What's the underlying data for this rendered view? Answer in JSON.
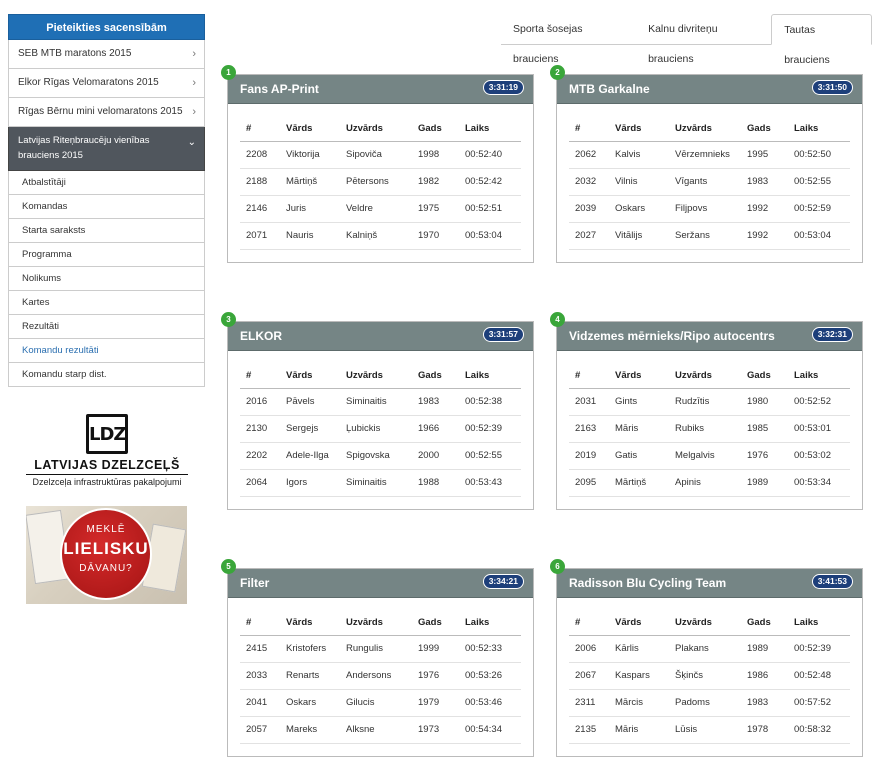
{
  "sidebar": {
    "header": "Pieteikties sacensībām",
    "items": [
      {
        "label": "SEB MTB maratons 2015"
      },
      {
        "label": "Elkor Rīgas Velomaratons 2015"
      },
      {
        "label": "Rīgas Bērnu mini velomaratons 2015"
      }
    ],
    "active": {
      "label": "Latvijas Riteņbraucēju vienības brauciens 2015"
    },
    "sub_items": [
      {
        "label": "Atbalstītāji"
      },
      {
        "label": "Komandas"
      },
      {
        "label": "Starta saraksts"
      },
      {
        "label": "Programma"
      },
      {
        "label": "Nolikums"
      },
      {
        "label": "Kartes"
      },
      {
        "label": "Rezultāti"
      },
      {
        "label": "Komandu rezultāti"
      },
      {
        "label": "Komandu starp dist."
      }
    ]
  },
  "ads": {
    "ldz": {
      "name": "LATVIJAS DZELZCEĻŠ",
      "tagline": "Dzelzceļa infrastruktūras pakalpojumi",
      "logo_text": "LDZ"
    },
    "promo": {
      "line1": "MEKLĒ",
      "line2": "LIELISKU",
      "line3": "DĀVANU?"
    }
  },
  "tabs": [
    {
      "label": "Sporta šosejas brauciens",
      "active": false
    },
    {
      "label": "Kalnu divriteņu brauciens",
      "active": false
    },
    {
      "label": "Tautas brauciens",
      "active": true
    }
  ],
  "columns": [
    "#",
    "Vārds",
    "Uzvārds",
    "Gads",
    "Laiks"
  ],
  "teams": [
    {
      "rank": "1",
      "name": "Fans AP-Print",
      "time": "3:31:19",
      "rows": [
        [
          "2208",
          "Viktorija",
          "Sipoviča",
          "1998",
          "00:52:40"
        ],
        [
          "2188",
          "Mārtiņš",
          "Pētersons",
          "1982",
          "00:52:42"
        ],
        [
          "2146",
          "Juris",
          "Veldre",
          "1975",
          "00:52:51"
        ],
        [
          "2071",
          "Nauris",
          "Kalniņš",
          "1970",
          "00:53:04"
        ]
      ]
    },
    {
      "rank": "2",
      "name": "MTB Garkalne",
      "time": "3:31:50",
      "rows": [
        [
          "2062",
          "Kalvis",
          "Vērzemnieks",
          "1995",
          "00:52:50"
        ],
        [
          "2032",
          "Vilnis",
          "Vīgants",
          "1983",
          "00:52:55"
        ],
        [
          "2039",
          "Oskars",
          "Filjpovs",
          "1992",
          "00:52:59"
        ],
        [
          "2027",
          "Vitālijs",
          "Seržans",
          "1992",
          "00:53:04"
        ]
      ]
    },
    {
      "rank": "3",
      "name": "ELKOR",
      "time": "3:31:57",
      "rows": [
        [
          "2016",
          "Pāvels",
          "Siminaitis",
          "1983",
          "00:52:38"
        ],
        [
          "2130",
          "Sergejs",
          "Ļubickis",
          "1966",
          "00:52:39"
        ],
        [
          "2202",
          "Adele-Ilga",
          "Spigovska",
          "2000",
          "00:52:55"
        ],
        [
          "2064",
          "Igors",
          "Siminaitis",
          "1988",
          "00:53:43"
        ]
      ]
    },
    {
      "rank": "4",
      "name": "Vidzemes mērnieks/Ripo autocentrs",
      "time": "3:32:31",
      "rows": [
        [
          "2031",
          "Gints",
          "Rudzītis",
          "1980",
          "00:52:52"
        ],
        [
          "2163",
          "Māris",
          "Rubiks",
          "1985",
          "00:53:01"
        ],
        [
          "2019",
          "Gatis",
          "Melgalvis",
          "1976",
          "00:53:02"
        ],
        [
          "2095",
          "Mārtiņš",
          "Apinis",
          "1989",
          "00:53:34"
        ]
      ]
    },
    {
      "rank": "5",
      "name": "Filter",
      "time": "3:34:21",
      "rows": [
        [
          "2415",
          "Kristofers",
          "Rungulis",
          "1999",
          "00:52:33"
        ],
        [
          "2033",
          "Renarts",
          "Andersons",
          "1976",
          "00:53:26"
        ],
        [
          "2041",
          "Oskars",
          "Gilucis",
          "1979",
          "00:53:46"
        ],
        [
          "2057",
          "Mareks",
          "Alksne",
          "1973",
          "00:54:34"
        ]
      ]
    },
    {
      "rank": "6",
      "name": "Radisson Blu Cycling Team",
      "time": "3:41:53",
      "rows": [
        [
          "2006",
          "Kārlis",
          "Plakans",
          "1989",
          "00:52:39"
        ],
        [
          "2067",
          "Kaspars",
          "Šķinčs",
          "1986",
          "00:52:48"
        ],
        [
          "2311",
          "Mārcis",
          "Padoms",
          "1983",
          "00:57:52"
        ],
        [
          "2135",
          "Māris",
          "Lūsis",
          "1978",
          "00:58:32"
        ]
      ]
    }
  ]
}
